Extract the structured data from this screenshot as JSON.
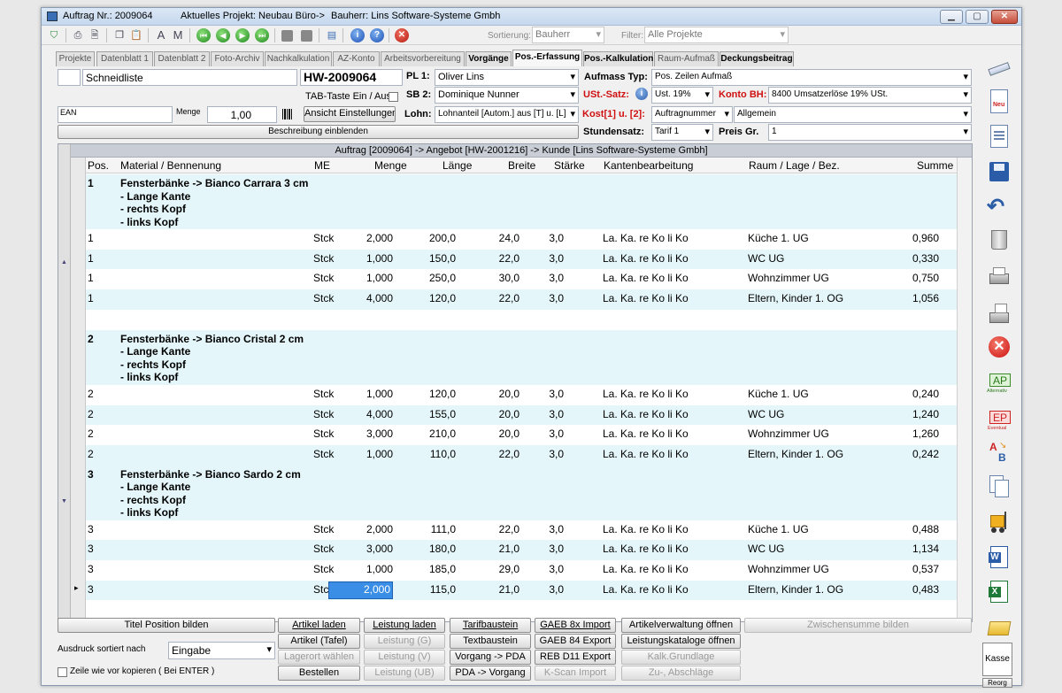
{
  "titlebar": {
    "order_label": "Auftrag Nr.: 2009064",
    "project_label": "Aktuelles Projekt: Neubau Büro->",
    "client_label": "Bauherr: Lins Software-Systeme Gmbh"
  },
  "toolbar": {
    "sort_label": "Sortierung:",
    "sort_value": "Bauherr",
    "filter_label": "Filter:",
    "filter_value": "Alle Projekte"
  },
  "tabs": [
    {
      "label": "Projekte"
    },
    {
      "label": "Datenblatt 1"
    },
    {
      "label": "Datenblatt 2"
    },
    {
      "label": "Foto-Archiv"
    },
    {
      "label": "Nachkalkulation"
    },
    {
      "label": "AZ-Konto"
    },
    {
      "label": "Arbeitsvorbereitung"
    },
    {
      "label": "Vorgänge"
    },
    {
      "label": "Pos.-Erfassung"
    },
    {
      "label": "Pos.-Kalkulation"
    },
    {
      "label": "Raum-Aufmaß"
    },
    {
      "label": "Deckungsbeitrag"
    }
  ],
  "form": {
    "list_name": "Schneidliste",
    "doc_number": "HW-2009064",
    "tab_toggle_label": "TAB-Taste Ein / Aus",
    "ean_label": "EAN",
    "menge_label": "Menge",
    "menge_value": "1,00",
    "view_settings_button": "Ansicht Einstellungen",
    "show_description_button": "Beschreibung einblenden",
    "pl1_label": "PL 1:",
    "pl1_value": "Oliver Lins",
    "sb2_label": "SB 2:",
    "sb2_value": "Dominique Nunner",
    "lohn_label": "Lohn:",
    "lohn_value": "Lohnanteil [Autom.] aus [T] u. [L]",
    "aufmass_typ_label": "Aufmass Typ:",
    "aufmass_typ_value": "Pos. Zeilen Aufmaß",
    "ust_satz_label": "USt.-Satz:",
    "ust_satz_value": "Ust. 19%",
    "konto_bh_label": "Konto BH:",
    "konto_bh_value": "8400 Umsatzerlöse 19% USt.",
    "kost_label": "Kost[1] u. [2]:",
    "kost1_value": "Auftragnummer",
    "kost2_value": "Allgemein",
    "stundensatz_label": "Stundensatz:",
    "stundensatz_value": "Tarif 1",
    "preis_gr_label": "Preis Gr.",
    "preis_gr_value": "1"
  },
  "grid": {
    "breadcrumb": "Auftrag [2009064] -> Angebot [HW-2001216] -> Kunde [Lins Software-Systeme Gmbh]",
    "columns": {
      "pos": "Pos.",
      "material": "Material / Bennenung",
      "me": "ME",
      "menge": "Menge",
      "laenge": "Länge",
      "breite": "Breite",
      "staerke": "Stärke",
      "kanten": "Kantenbearbeitung",
      "raum": "Raum / Lage / Bez.",
      "summe": "Summe"
    },
    "groups": [
      {
        "pos": "1",
        "title": "Fensterbänke -> Bianco Carrara 3 cm",
        "lines": [
          "- Lange Kante",
          "- rechts Kopf",
          "- links Kopf"
        ],
        "items": [
          {
            "pos": "1",
            "me": "Stck",
            "menge": "2,000",
            "laenge": "200,0",
            "breite": "24,0",
            "staerke": "3,0",
            "kanten": "La. Ka. re Ko li Ko",
            "raum": "Küche 1. UG",
            "summe": "0,960"
          },
          {
            "pos": "1",
            "me": "Stck",
            "menge": "1,000",
            "laenge": "150,0",
            "breite": "22,0",
            "staerke": "3,0",
            "kanten": "La. Ka. re Ko li Ko",
            "raum": "WC UG",
            "summe": "0,330"
          },
          {
            "pos": "1",
            "me": "Stck",
            "menge": "1,000",
            "laenge": "250,0",
            "breite": "30,0",
            "staerke": "3,0",
            "kanten": "La. Ka. re Ko li Ko",
            "raum": "Wohnzimmer UG",
            "summe": "0,750"
          },
          {
            "pos": "1",
            "me": "Stck",
            "menge": "4,000",
            "laenge": "120,0",
            "breite": "22,0",
            "staerke": "3,0",
            "kanten": "La. Ka. re Ko li Ko",
            "raum": "Eltern, Kinder 1. OG",
            "summe": "1,056"
          }
        ]
      },
      {
        "pos": "2",
        "title": "Fensterbänke -> Bianco Cristal 2 cm",
        "lines": [
          "- Lange Kante",
          "- rechts Kopf",
          "- links Kopf"
        ],
        "items": [
          {
            "pos": "2",
            "me": "Stck",
            "menge": "1,000",
            "laenge": "120,0",
            "breite": "20,0",
            "staerke": "3,0",
            "kanten": "La. Ka. re Ko li Ko",
            "raum": "Küche 1. UG",
            "summe": "0,240"
          },
          {
            "pos": "2",
            "me": "Stck",
            "menge": "4,000",
            "laenge": "155,0",
            "breite": "20,0",
            "staerke": "3,0",
            "kanten": "La. Ka. re Ko li Ko",
            "raum": "WC UG",
            "summe": "1,240"
          },
          {
            "pos": "2",
            "me": "Stck",
            "menge": "3,000",
            "laenge": "210,0",
            "breite": "20,0",
            "staerke": "3,0",
            "kanten": "La. Ka. re Ko li Ko",
            "raum": "Wohnzimmer UG",
            "summe": "1,260"
          },
          {
            "pos": "2",
            "me": "Stck",
            "menge": "1,000",
            "laenge": "110,0",
            "breite": "22,0",
            "staerke": "3,0",
            "kanten": "La. Ka. re Ko li Ko",
            "raum": "Eltern, Kinder 1. OG",
            "summe": "0,242"
          }
        ]
      },
      {
        "pos": "3",
        "title": "Fensterbänke -> Bianco Sardo 2 cm",
        "lines": [
          "- Lange Kante",
          "- rechts Kopf",
          "- links Kopf"
        ],
        "items": [
          {
            "pos": "3",
            "me": "Stck",
            "menge": "2,000",
            "laenge": "111,0",
            "breite": "22,0",
            "staerke": "3,0",
            "kanten": "La. Ka. re Ko li Ko",
            "raum": "Küche 1. UG",
            "summe": "0,488"
          },
          {
            "pos": "3",
            "me": "Stck",
            "menge": "3,000",
            "laenge": "180,0",
            "breite": "21,0",
            "staerke": "3,0",
            "kanten": "La. Ka. re Ko li Ko",
            "raum": "WC UG",
            "summe": "1,134"
          },
          {
            "pos": "3",
            "me": "Stck",
            "menge": "1,000",
            "laenge": "185,0",
            "breite": "29,0",
            "staerke": "3,0",
            "kanten": "La. Ka. re Ko li Ko",
            "raum": "Wohnzimmer UG",
            "summe": "0,537"
          },
          {
            "pos": "3",
            "me": "Stck",
            "menge": "2,000",
            "laenge": "115,0",
            "breite": "21,0",
            "staerke": "3,0",
            "kanten": "La. Ka. re Ko li Ko",
            "raum": "Eltern, Kinder 1. OG",
            "summe": "0,483"
          }
        ]
      }
    ]
  },
  "bottom": {
    "title_position_button": "Titel Position bilden",
    "print_sort_label": "Ausdruck sortiert nach",
    "print_sort_value": "Eingabe",
    "copy_row_label": "Zeile wie vor kopieren ( Bei ENTER )",
    "buttons": {
      "artikel_laden": "Artikel laden",
      "artikel_tafel": "Artikel (Tafel)",
      "lagerort_waehlen": "Lagerort wählen",
      "bestellen": "Bestellen",
      "leistung_laden": "Leistung laden",
      "leistung_g": "Leistung (G)",
      "leistung_v": "Leistung (V)",
      "leistung_ub": "Leistung (UB)",
      "tarifbaustein": "Tarifbaustein",
      "textbaustein": "Textbaustein",
      "vorgang_pda": "Vorgang -> PDA",
      "pda_vorgang": "PDA -> Vorgang",
      "gaeb_8x_import": "GAEB 8x Import",
      "gaeb_84_export": "GAEB 84 Export",
      "reb_d11_export": "REB D11 Export",
      "kscan_import": "K-Scan Import",
      "artikelverwaltung": "Artikelverwaltung öffnen",
      "leistungskataloge": "Leistungskataloge öffnen",
      "kalk_grundlage": "Kalk.Grundlage",
      "zu_abschlaege": "Zu-, Abschläge",
      "zwischensumme": "Zwischensumme bilden"
    }
  },
  "sidebar": {
    "neu_label": "Neu",
    "ap_label": "AP",
    "ap_sub": "Alternativ",
    "ep_label": "EP",
    "ep_sub": "Eventual",
    "kasse_label": "Kasse",
    "reorg_label": "Reorg"
  },
  "colors": {
    "group_row_bg": "#e4f6fa",
    "label_red": "#d01010",
    "edit_cell": "#3a8ee6"
  }
}
